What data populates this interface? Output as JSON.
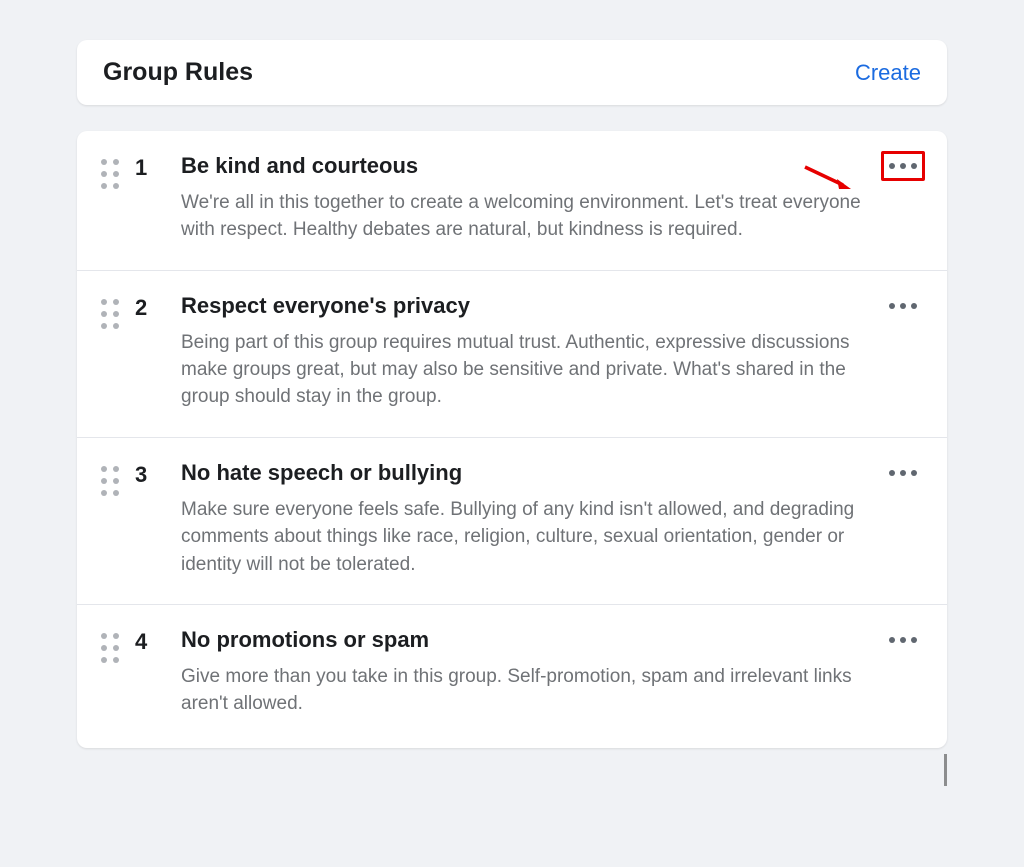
{
  "header": {
    "title": "Group Rules",
    "create_label": "Create"
  },
  "rules": [
    {
      "number": "1",
      "title": "Be kind and courteous",
      "description": "We're all in this together to create a welcoming environment. Let's treat everyone with respect. Healthy debates are natural, but kindness is required."
    },
    {
      "number": "2",
      "title": "Respect everyone's privacy",
      "description": "Being part of this group requires mutual trust. Authentic, expressive discussions make groups great, but may also be sensitive and private. What's shared in the group should stay in the group."
    },
    {
      "number": "3",
      "title": "No hate speech or bullying",
      "description": "Make sure everyone feels safe. Bullying of any kind isn't allowed, and degrading comments about things like race, religion, culture, sexual orientation, gender or identity will not be tolerated."
    },
    {
      "number": "4",
      "title": "No promotions or spam",
      "description": "Give more than you take in this group. Self-promotion, spam and irrelevant links aren't allowed."
    }
  ],
  "annotation": {
    "highlight_color": "#e60000"
  }
}
